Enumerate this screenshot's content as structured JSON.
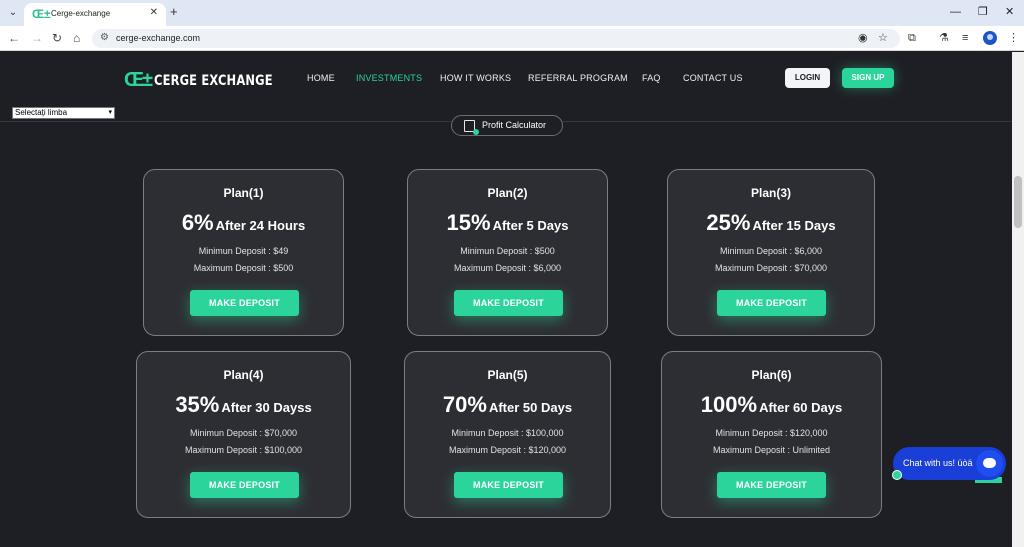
{
  "browser": {
    "tab_title": "Cerge-exchange",
    "favicon_glyph": "Œ±",
    "url": "cerge-exchange.com"
  },
  "site": {
    "logo_mark": "Œ±",
    "logo_text": "CERGE EXCHANGE",
    "nav": [
      "HOME",
      "INVESTMENTS",
      "HOW IT WORKS",
      "REFERRAL PROGRAM",
      "FAQ",
      "CONTACT US"
    ],
    "active_nav": "INVESTMENTS",
    "login_label": "LOGIN",
    "signup_label": "SIGN UP",
    "language_select": "Selectați limba",
    "profit_calculator_label": "Profit Calculator",
    "accent_color": "#2bd49a"
  },
  "plans": [
    {
      "name": "Plan(1)",
      "percent": "6%",
      "period": "After 24 Hours",
      "min": "Minimun Deposit : $49",
      "max": "Maximum Deposit : $500",
      "button": "MAKE DEPOSIT"
    },
    {
      "name": "Plan(2)",
      "percent": "15%",
      "period": "After 5 Days",
      "min": "Minimun Deposit : $500",
      "max": "Maximum Deposit : $6,000",
      "button": "MAKE DEPOSIT"
    },
    {
      "name": "Plan(3)",
      "percent": "25%",
      "period": "After 15 Days",
      "min": "Minimun Deposit : $6,000",
      "max": "Maximum Deposit : $70,000",
      "button": "MAKE DEPOSIT"
    },
    {
      "name": "Plan(4)",
      "percent": "35%",
      "period": "After 30 Dayss",
      "min": "Minimun Deposit : $70,000",
      "max": "Maximum Deposit : $100,000",
      "button": "MAKE DEPOSIT"
    },
    {
      "name": "Plan(5)",
      "percent": "70%",
      "period": "After 50 Days",
      "min": "Minimun Deposit : $100,000",
      "max": "Maximum Deposit : $120,000",
      "button": "MAKE DEPOSIT"
    },
    {
      "name": "Plan(6)",
      "percent": "100%",
      "period": "After 60 Days",
      "min": "Minimun Deposit : $120,000",
      "max": "Maximum Deposit : Unlimited",
      "button": "MAKE DEPOSIT"
    }
  ],
  "chat": {
    "label": "Chat with us!",
    "emoji": "üòä"
  }
}
